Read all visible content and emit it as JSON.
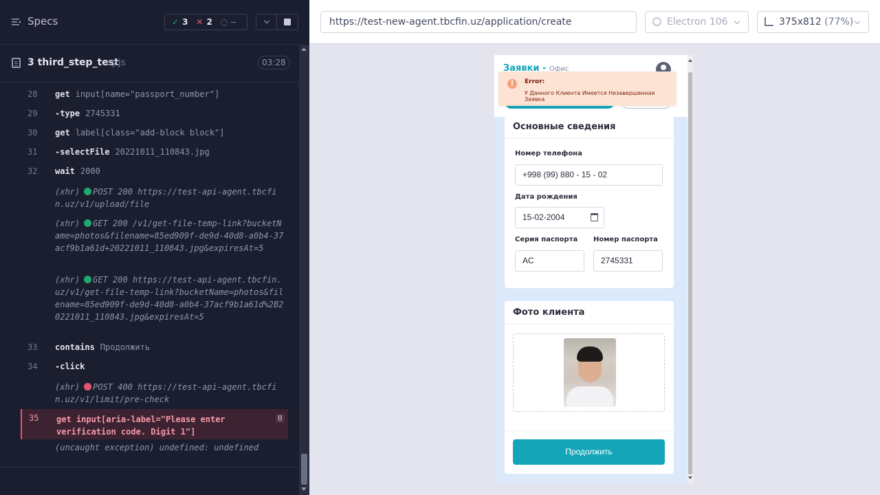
{
  "specs": {
    "title": "Specs",
    "passed": "3",
    "failed": "2",
    "pending": "--"
  },
  "file": {
    "name": "3 third_step_test",
    "ext": "cy.js",
    "duration": "03:28"
  },
  "commands": [
    {
      "line": "28",
      "name": "get",
      "arg": "input[name=\"passport_number\"]"
    },
    {
      "line": "29",
      "name": "-type",
      "arg": "2745331"
    },
    {
      "line": "30",
      "name": "get",
      "arg": "label[class=\"add-block block\"]"
    },
    {
      "line": "31",
      "name": "-selectFile",
      "arg": "20221011_110843.jpg"
    },
    {
      "line": "32",
      "name": "wait",
      "arg": "2000"
    },
    {
      "line": "33",
      "name": "contains",
      "arg": "Продолжить"
    },
    {
      "line": "34",
      "name": "-click",
      "arg": ""
    }
  ],
  "xhr": [
    {
      "prefix": "(xhr)",
      "text": "POST 200 https://test-api-agent.tbcfin.uz/v1/upload/file",
      "status": "ok"
    },
    {
      "prefix": "(xhr)",
      "text": "GET 200 /v1/get-file-temp-link?bucketName=photos&filename=85ed909f-de9d-40d8-a0b4-37acf9b1a61d+20221011_110843.jpg&expiresAt=5",
      "status": "ok"
    },
    {
      "prefix": "(xhr)",
      "text": "GET 200 https://test-api-agent.tbcfin.uz/v1/get-file-temp-link?bucketName=photos&filename=85ed909f-de9d-40d8-a0b4-37acf9b1a61d%2B20221011_110843.jpg&expiresAt=5",
      "status": "ok"
    },
    {
      "prefix": "(xhr)",
      "text": "POST 400 https://test-api-agent.tbcfin.uz/v1/limit/pre-check",
      "status": "error"
    }
  ],
  "error_command": {
    "line": "35",
    "text": "get  input[aria-label=\"Please enter verification code. Digit 1\"]",
    "count": "0"
  },
  "exception": "(uncaught exception)  undefined: undefined",
  "browser": {
    "url": "https://test-new-agent.tbcfin.uz/application/create",
    "name": "Electron 106",
    "viewport": "375x812",
    "zoom": "(77%)"
  },
  "app": {
    "title": "Заявки -",
    "subtitle": "Офис",
    "toast": {
      "title": "Error:",
      "message": "У Данного Клиента Имеется Незавершенная Заявка"
    },
    "main_info": {
      "title": "Основные сведения",
      "phone_label": "Номер телефона",
      "phone_value": "+998 (99) 880 - 15 - 02",
      "birth_label": "Дата рождения",
      "birth_value": "15-02-2004",
      "series_label": "Серия паспорта",
      "series_value": "AC",
      "number_label": "Номер паспорта",
      "number_value": "2745331"
    },
    "photo": {
      "title": "Фото клиента"
    },
    "continue_label": "Продолжить"
  },
  "colors": {
    "accent": "#14a5b8",
    "pass": "#1fa971",
    "fail": "#e45770"
  }
}
